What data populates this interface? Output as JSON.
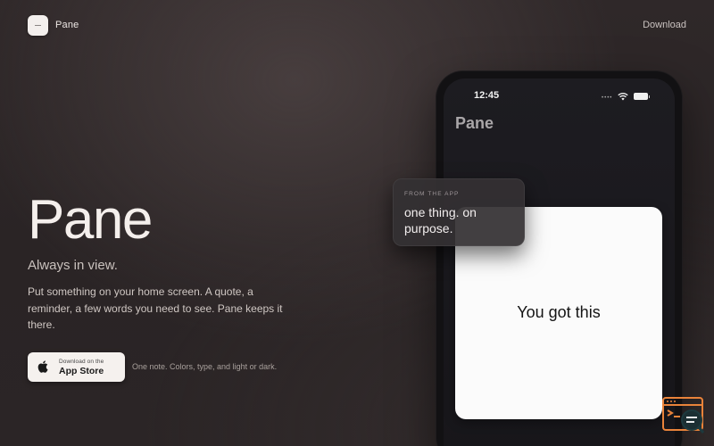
{
  "header": {
    "brand_name": "Pane",
    "download_label": "Download"
  },
  "hero": {
    "title": "Pane",
    "tagline": "Always in view.",
    "description": "Put something on your home screen. A quote, a reminder, a few words you need to see. Pane keeps it there.",
    "store_button": {
      "small_label": "Download on the",
      "big_label": "App Store",
      "icon": "apple-icon"
    },
    "store_note": "One note. Colors, type, and light or dark."
  },
  "phone": {
    "status_time": "12:45",
    "status_icons": [
      "signal-dots-icon",
      "wifi-icon",
      "battery-icon"
    ],
    "app_title": "Pane",
    "widget_text": "You got this"
  },
  "popup": {
    "label": "FROM THE APP",
    "text": "one thing. on purpose."
  },
  "colors": {
    "background": "#2b2526",
    "widget_bg": "#fbfbfb",
    "accent_badge": "#e9833a"
  }
}
